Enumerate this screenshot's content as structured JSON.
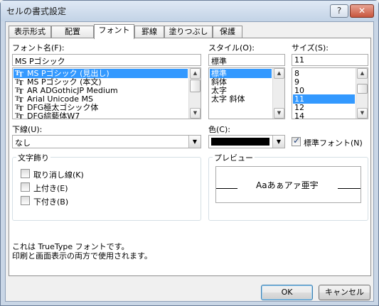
{
  "window": {
    "title": "セルの書式設定",
    "help_label": "?",
    "close_label": "✕"
  },
  "tabs": [
    {
      "label": "表示形式"
    },
    {
      "label": "配置"
    },
    {
      "label": "フォント",
      "active": true
    },
    {
      "label": "罫線"
    },
    {
      "label": "塗りつぶし"
    },
    {
      "label": "保護"
    }
  ],
  "font_name": {
    "label": "フォント名(F):",
    "value": "MS Pゴシック",
    "items": [
      {
        "label": "MS Pゴシック (見出し)",
        "selected": true
      },
      {
        "label": "MS Pゴシック (本文)"
      },
      {
        "label": "AR ADGothicJP Medium"
      },
      {
        "label": "Arial Unicode MS"
      },
      {
        "label": "DFG極太ゴシック体"
      },
      {
        "label": "DFG綜藝体W7"
      }
    ]
  },
  "style": {
    "label": "スタイル(O):",
    "value": "標準",
    "items": [
      {
        "label": "標準",
        "selected": true
      },
      {
        "label": "斜体"
      },
      {
        "label": "太字"
      },
      {
        "label": "太字 斜体"
      }
    ]
  },
  "size": {
    "label": "サイズ(S):",
    "value": "11",
    "items": [
      {
        "label": "8"
      },
      {
        "label": "9"
      },
      {
        "label": "10"
      },
      {
        "label": "11",
        "selected": true
      },
      {
        "label": "12"
      },
      {
        "label": "14"
      }
    ]
  },
  "underline": {
    "label": "下線(U):",
    "value": "なし"
  },
  "color": {
    "label": "色(C):",
    "swatch": "#000000",
    "standard_font_label": "標準フォント(N)",
    "standard_font_checked": true
  },
  "effects": {
    "title": "文字飾り",
    "items": [
      {
        "label": "取り消し線(K)",
        "checked": false
      },
      {
        "label": "上付き(E)",
        "checked": false
      },
      {
        "label": "下付き(B)",
        "checked": false
      }
    ]
  },
  "preview": {
    "title": "プレビュー",
    "sample": "Aaあぁアァ亜宇"
  },
  "description": {
    "line1": "これは TrueType フォントです。",
    "line2": "印刷と画面表示の両方で使用されます。"
  },
  "buttons": {
    "ok": "OK",
    "cancel": "キャンセル"
  },
  "colors": {
    "selection": "#3399ff",
    "titlebar": "#c9d6e6"
  }
}
